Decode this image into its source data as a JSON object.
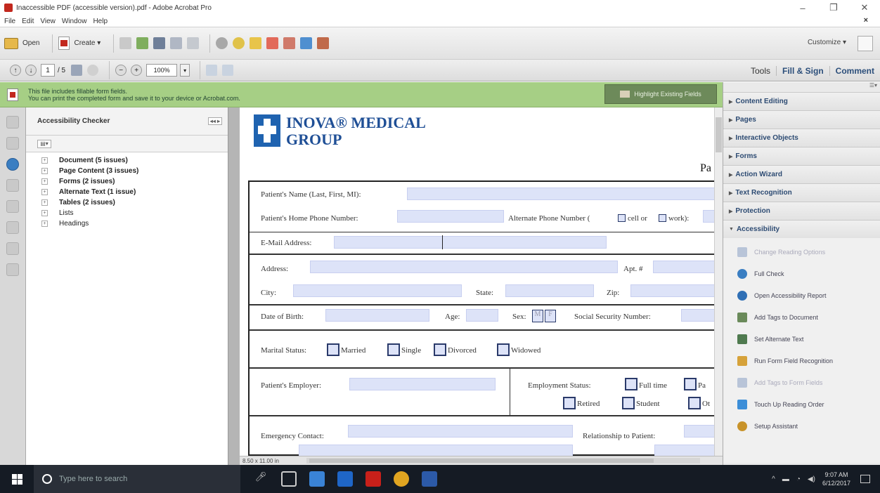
{
  "window": {
    "title": "Inaccessible PDF (accessible version).pdf - Adobe Acrobat Pro"
  },
  "menu": [
    "File",
    "Edit",
    "View",
    "Window",
    "Help"
  ],
  "toolbar": {
    "open": "Open",
    "create": "Create ▾",
    "customize": "Customize ▾"
  },
  "nav": {
    "page": "1",
    "page_total": "/ 5",
    "zoom": "100%"
  },
  "tasks": {
    "tools": "Tools",
    "fill_sign": "Fill & Sign",
    "comment": "Comment"
  },
  "notice": {
    "line1": "This file includes fillable form fields.",
    "line2": "You can print the completed form and save it to your device or Acrobat.com.",
    "highlight_button": "Highlight Existing Fields"
  },
  "accessibility_checker": {
    "title": "Accessibility Checker",
    "items": [
      {
        "label": "Document (5 issues)",
        "bold": true
      },
      {
        "label": "Page Content (3 issues)",
        "bold": true
      },
      {
        "label": "Forms (2 issues)",
        "bold": true
      },
      {
        "label": "Alternate Text (1 issue)",
        "bold": true
      },
      {
        "label": "Tables (2 issues)",
        "bold": true
      },
      {
        "label": "Lists",
        "bold": false
      },
      {
        "label": "Headings",
        "bold": false
      }
    ]
  },
  "document": {
    "logo_line1": "INOVA® MEDICAL",
    "logo_line2": "GROUP",
    "page_hint": "Pa",
    "page_size": "8.50 x 11.00 in",
    "form": {
      "patient_name": "Patient's Name (Last, First, MI):",
      "home_phone": "Patient's Home Phone Number:",
      "alt_phone_a": "Alternate Phone Number (",
      "cell": "cell or",
      "work": "work):",
      "email": "E-Mail Address:",
      "address": "Address:",
      "apt": "Apt. #",
      "city": "City:",
      "state": "State:",
      "zip": "Zip:",
      "dob": "Date of Birth:",
      "age": "Age:",
      "sex": "Sex:",
      "sex_m": "M",
      "sex_f": "F",
      "ssn": "Social Security Number:",
      "marital": "Marital Status:",
      "married": "Married",
      "single": "Single",
      "divorced": "Divorced",
      "widowed": "Widowed",
      "employer": "Patient's Employer:",
      "emp_status": "Employment Status:",
      "full_time": "Full time",
      "part_time": "Pa",
      "retired": "Retired",
      "student": "Student",
      "other": "Ot",
      "emergency": "Emergency Contact:",
      "relationship": "Relationship to Patient:"
    }
  },
  "tools_panel": {
    "sections": [
      "Content Editing",
      "Pages",
      "Interactive Objects",
      "Forms",
      "Action Wizard",
      "Text Recognition",
      "Protection"
    ],
    "open_section": "Accessibility",
    "items": [
      {
        "label": "Change Reading Options",
        "disabled": true,
        "color": "#b8c4d8"
      },
      {
        "label": "Full Check",
        "disabled": false,
        "color": "#3a7ec2"
      },
      {
        "label": "Open Accessibility Report",
        "disabled": false,
        "color": "#2f6fb5"
      },
      {
        "label": "Add Tags to Document",
        "disabled": false,
        "color": "#6a8a5a"
      },
      {
        "label": "Set Alternate Text",
        "disabled": false,
        "color": "#4f7a4f"
      },
      {
        "label": "Run Form Field Recognition",
        "disabled": false,
        "color": "#d6a23a"
      },
      {
        "label": "Add Tags to Form Fields",
        "disabled": true,
        "color": "#b8c4d8"
      },
      {
        "label": "Touch Up Reading Order",
        "disabled": false,
        "color": "#3c8ed8"
      },
      {
        "label": "Setup Assistant",
        "disabled": false,
        "color": "#c8932a"
      }
    ]
  },
  "taskbar": {
    "search_placeholder": "Type here to search",
    "time": "9:07 AM",
    "date": "6/12/2017"
  }
}
